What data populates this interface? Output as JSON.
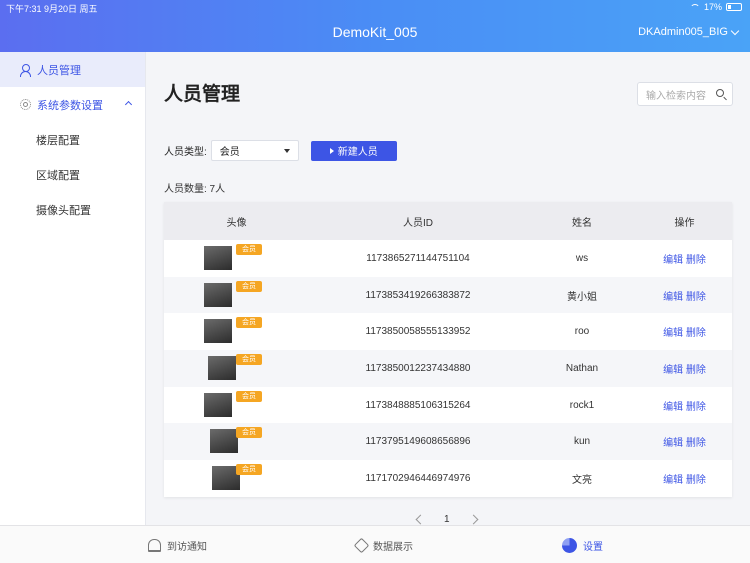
{
  "status_bar": {
    "time_date": "下午7:31   9月20日 周五",
    "battery": "17%"
  },
  "header": {
    "app_title": "DemoKit_005",
    "user": "DKAdmin005_BIG"
  },
  "sidebar": {
    "items": [
      {
        "label": "人员管理",
        "icon": "user-icon"
      },
      {
        "label": "系统参数设置",
        "icon": "gear-icon"
      },
      {
        "label": "楼层配置"
      },
      {
        "label": "区域配置"
      },
      {
        "label": "摄像头配置"
      }
    ]
  },
  "main": {
    "title": "人员管理",
    "search_placeholder": "输入检索内容",
    "filter_label": "人员类型:",
    "filter_value": "会员",
    "new_button": "新建人员",
    "count": "人员数量: 7人",
    "columns": [
      "头像",
      "人员ID",
      "姓名",
      "操作"
    ],
    "rows": [
      {
        "tag": "会员",
        "id": "1173865271144751104",
        "name": "ws",
        "edit": "编辑",
        "delete": "删除"
      },
      {
        "tag": "会员",
        "id": "1173853419266383872",
        "name": "黄小姐",
        "edit": "编辑",
        "delete": "删除"
      },
      {
        "tag": "会员",
        "id": "1173850058555133952",
        "name": "roo",
        "edit": "编辑",
        "delete": "删除"
      },
      {
        "tag": "会员",
        "id": "1173850012237434880",
        "name": "Nathan",
        "edit": "编辑",
        "delete": "删除"
      },
      {
        "tag": "会员",
        "id": "1173848885106315264",
        "name": "rock1",
        "edit": "编辑",
        "delete": "删除"
      },
      {
        "tag": "会员",
        "id": "1173795149608656896",
        "name": "kun",
        "edit": "编辑",
        "delete": "删除"
      },
      {
        "tag": "会员",
        "id": "1171702946446974976",
        "name": "文亮",
        "edit": "编辑",
        "delete": "删除"
      }
    ],
    "page": "1"
  },
  "tabbar": {
    "tabs": [
      {
        "label": "到访通知",
        "icon": "bell-icon"
      },
      {
        "label": "数据展示",
        "icon": "diamond-icon"
      },
      {
        "label": "设置",
        "icon": "settings-pie-icon"
      }
    ]
  },
  "colors": {
    "accent": "#3d55e5",
    "tag": "#f5a623"
  }
}
